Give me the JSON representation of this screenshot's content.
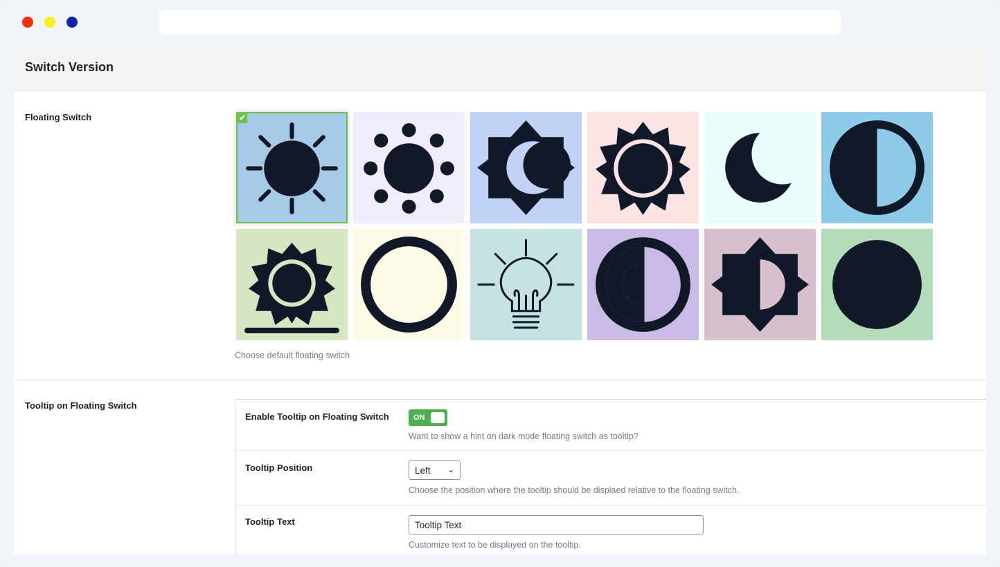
{
  "window": {
    "controls": [
      "close",
      "minimize",
      "maximize"
    ],
    "colors": {
      "close": "#f22d10",
      "minimize": "#f5f01b",
      "maximize": "#0d24a8"
    }
  },
  "section": {
    "title": "Switch Version"
  },
  "floating_switch": {
    "label": "Floating Switch",
    "hint": "Choose default floating switch",
    "selected_index": 0,
    "selected_mark": "✔",
    "options": [
      {
        "icon": "sun-rays-icon",
        "bg": "#a5c9e6"
      },
      {
        "icon": "sun-dots-icon",
        "bg": "#f0ecfb"
      },
      {
        "icon": "star-moon-icon",
        "bg": "#c0d3f7"
      },
      {
        "icon": "star-ring-icon",
        "bg": "#fde4e4"
      },
      {
        "icon": "crescent-moon-icon",
        "bg": "#e8fdfc"
      },
      {
        "icon": "half-circle-icon",
        "bg": "#8ecbe8"
      },
      {
        "icon": "sunrise-icon",
        "bg": "#d5e6c1"
      },
      {
        "icon": "ring-icon",
        "bg": "#fefbe6"
      },
      {
        "icon": "lightbulb-icon",
        "bg": "#c3e2e1"
      },
      {
        "icon": "contrast-ring-icon",
        "bg": "#c9bbe6"
      },
      {
        "icon": "star-half-icon",
        "bg": "#d8bfcc"
      },
      {
        "icon": "full-circle-icon",
        "bg": "#b3dcb9"
      }
    ]
  },
  "tooltip": {
    "label": "Tooltip on Floating Switch",
    "enable": {
      "label": "Enable Tooltip on Floating Switch",
      "state": "ON",
      "hint": "Want to show a hint on dark mode floating switch as tooltip?"
    },
    "position": {
      "label": "Tooltip Position",
      "value": "Left",
      "hint": "Choose the position where the tooltip should be displaed relative to the floating switch."
    },
    "text": {
      "label": "Tooltip Text",
      "value": "Tooltip Text",
      "hint": "Customize text to be displayed on the tooltip."
    }
  }
}
